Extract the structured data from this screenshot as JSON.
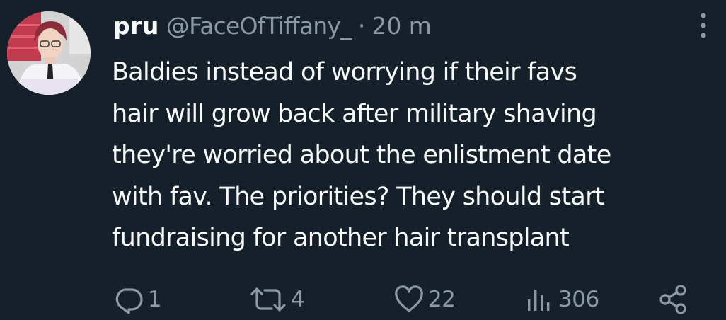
{
  "tweet": {
    "display_name": "pru",
    "handle": "@FaceOfTiffany_",
    "separator": "·",
    "time": "20 m",
    "text": "Baldies instead of worrying if their favs\nhair will grow back after military shaving\nthey're worried about the enlistment date\nwith fav. The priorities? They should start\nfundraising for another hair transplant"
  },
  "actions": {
    "replies": "1",
    "retweets": "4",
    "likes": "22",
    "views": "306"
  },
  "icons": {
    "reply": "reply-icon",
    "retweet": "retweet-icon",
    "like": "heart-icon",
    "views": "views-icon",
    "share": "share-icon",
    "more": "more-vertical-icon"
  },
  "colors": {
    "background": "#15202b",
    "primary_text": "#f7f9f9",
    "secondary_text": "#8b98a5"
  }
}
